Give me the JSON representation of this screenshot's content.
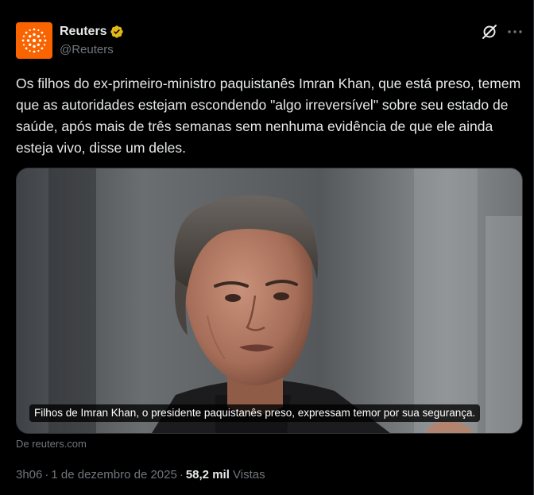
{
  "author": {
    "name": "Reuters",
    "handle": "@Reuters"
  },
  "colors": {
    "avatar_bg": "#fa6400",
    "verified_badge": "#e2b719",
    "muted_text": "#71767b",
    "primary_text": "#e7e9ea"
  },
  "tweet": {
    "text": "Os filhos do ex-primeiro-ministro paquistanês Imran Khan, que está preso, temem que as autoridades estejam escondendo \"algo irreversível\" sobre seu estado de saúde, após mais de três semanas sem nenhuma evidência de que ele ainda esteja vivo, disse um deles."
  },
  "media": {
    "caption": "Filhos de Imran Khan, o presidente paquistanês preso, expressam temor por sua segurança.",
    "source": "De reuters.com"
  },
  "meta": {
    "time": "3h06",
    "date": "1 de dezembro de 2025",
    "separator": "·",
    "views_count": "58,2 mil",
    "views_label": "Vistas"
  },
  "icons": {
    "grok": "grok-icon",
    "more": "more-icon",
    "verified": "verified-badge-icon"
  }
}
